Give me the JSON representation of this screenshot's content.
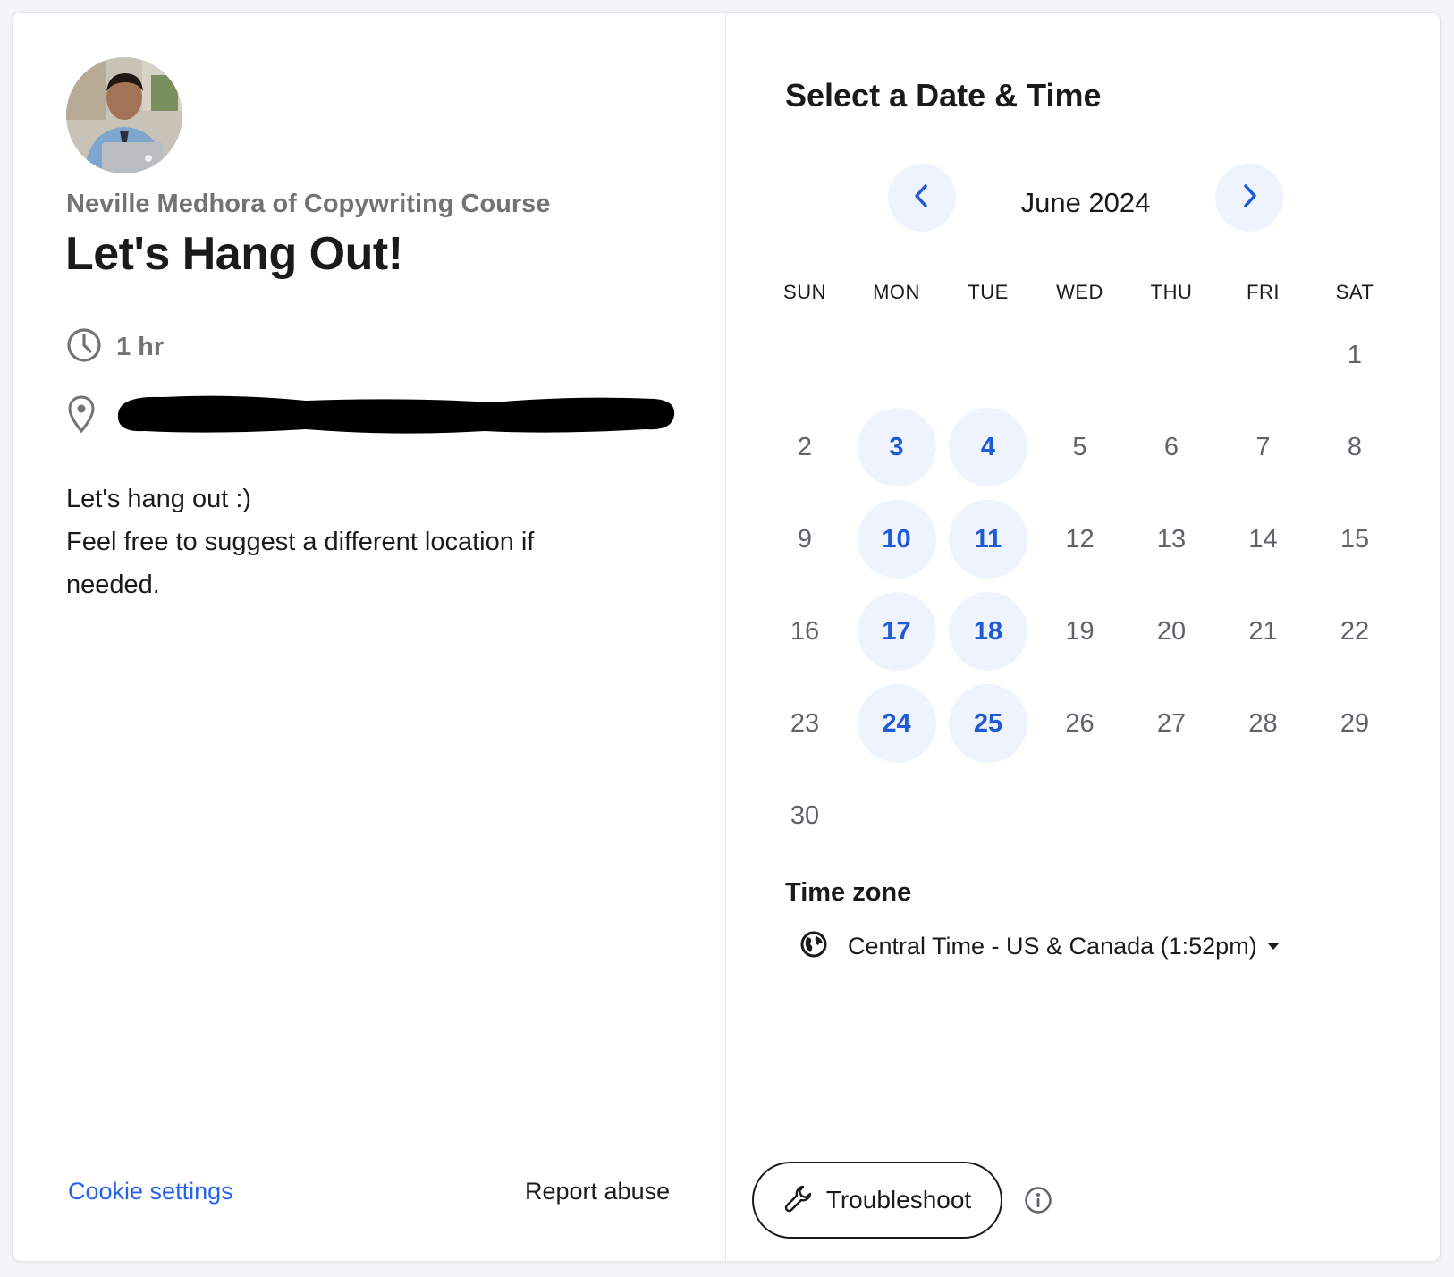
{
  "profile": {
    "organizer": "Neville Medhora of Copywriting Course",
    "event_title": "Let's Hang Out!",
    "duration": "1 hr",
    "description_lines": [
      "Let's hang out :)",
      "Feel free to suggest a different location if needed."
    ]
  },
  "footer": {
    "cookie_settings": "Cookie settings",
    "report_abuse": "Report abuse"
  },
  "scheduler": {
    "heading": "Select a Date & Time",
    "month": "June 2024",
    "weekdays": [
      "SUN",
      "MON",
      "TUE",
      "WED",
      "THU",
      "FRI",
      "SAT"
    ],
    "first_weekday_index": 6,
    "days_in_month": 30,
    "available_days": [
      3,
      4,
      10,
      11,
      17,
      18,
      24,
      25
    ],
    "timezone_label": "Time zone",
    "timezone_value": "Central Time - US & Canada (1:52pm)",
    "troubleshoot_label": "Troubleshoot"
  },
  "icons": {
    "prev": "chevron-left-icon",
    "next": "chevron-right-icon",
    "clock": "clock-icon",
    "location": "location-pin-icon",
    "globe": "globe-icon",
    "wrench": "wrench-icon",
    "info": "info-icon"
  },
  "colors": {
    "accent": "#1f5bd6",
    "available_bg": "#eef3fd",
    "link": "#2563eb",
    "muted": "#737373"
  }
}
